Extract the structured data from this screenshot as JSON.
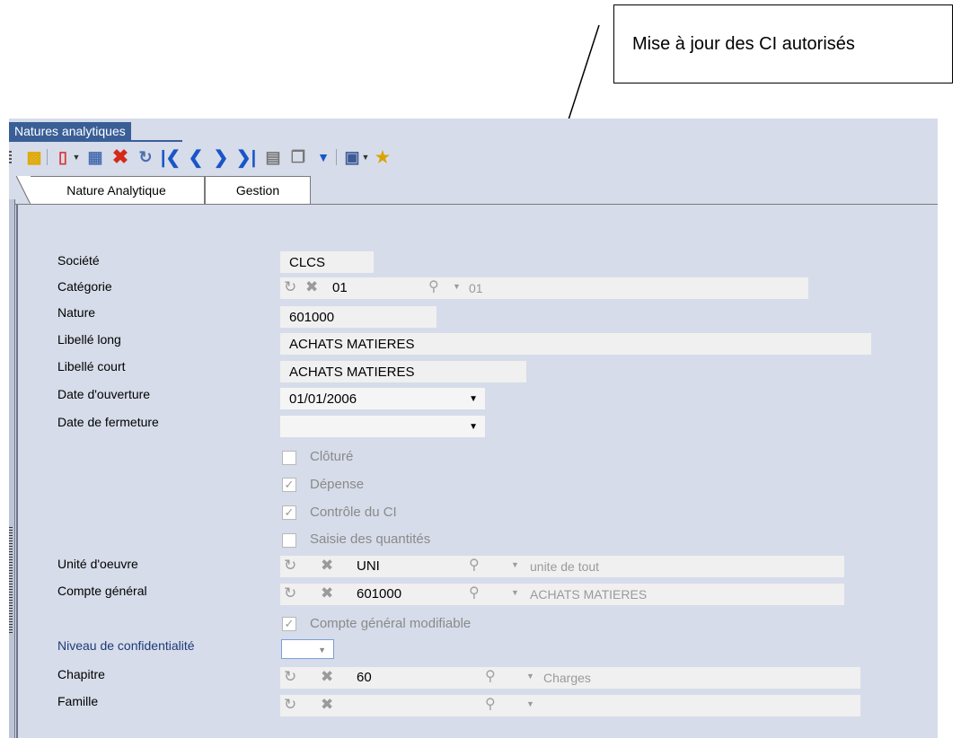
{
  "callout": {
    "text": "Mise à jour des CI autorisés"
  },
  "window": {
    "title": "Natures analytiques"
  },
  "toolbar": {
    "icons": [
      "lock-icon",
      "new-document-icon",
      "save-icon",
      "delete-icon",
      "refresh-icon",
      "first-record-icon",
      "previous-record-icon",
      "next-record-icon",
      "last-record-icon",
      "notes-icon",
      "copy-icon",
      "more-dropdown-icon",
      "report-icon",
      "update-authorized-ci-icon"
    ]
  },
  "tabs": [
    {
      "label": "Nature Analytique"
    },
    {
      "label": "Gestion"
    }
  ],
  "form": {
    "societe": {
      "label": "Société",
      "value": "CLCS"
    },
    "categorie": {
      "label": "Catégorie",
      "code": "01",
      "desc": "01"
    },
    "nature": {
      "label": "Nature",
      "value": "601000"
    },
    "libelle_long": {
      "label": "Libellé long",
      "value": "ACHATS MATIERES"
    },
    "libelle_court": {
      "label": "Libellé court",
      "value": "ACHATS MATIERES"
    },
    "date_ouverture": {
      "label": "Date d'ouverture",
      "value": "01/01/2006"
    },
    "date_fermeture": {
      "label": "Date de fermeture",
      "value": ""
    },
    "cloture": {
      "label": "Clôturé",
      "checked": false
    },
    "depense": {
      "label": "Dépense",
      "checked": true
    },
    "controle_ci": {
      "label": "Contrôle du CI",
      "checked": true
    },
    "saisie_quantites": {
      "label": "Saisie des quantités",
      "checked": false
    },
    "unite_oeuvre": {
      "label": "Unité d'oeuvre",
      "code": "UNI",
      "desc": "unite de tout"
    },
    "compte_general": {
      "label": "Compte général",
      "code": "601000",
      "desc": "ACHATS MATIERES"
    },
    "compte_modifiable": {
      "label": "Compte général modifiable",
      "checked": true
    },
    "niveau_confidentialite": {
      "label": "Niveau de confidentialité",
      "value": ""
    },
    "chapitre": {
      "label": "Chapitre",
      "code": "60",
      "desc": "Charges"
    },
    "famille": {
      "label": "Famille",
      "code": "",
      "desc": ""
    }
  },
  "colors": {
    "window_bg": "#d6dce9",
    "title_tab": "#3a5f97",
    "field_bg": "#f0f0f0"
  }
}
